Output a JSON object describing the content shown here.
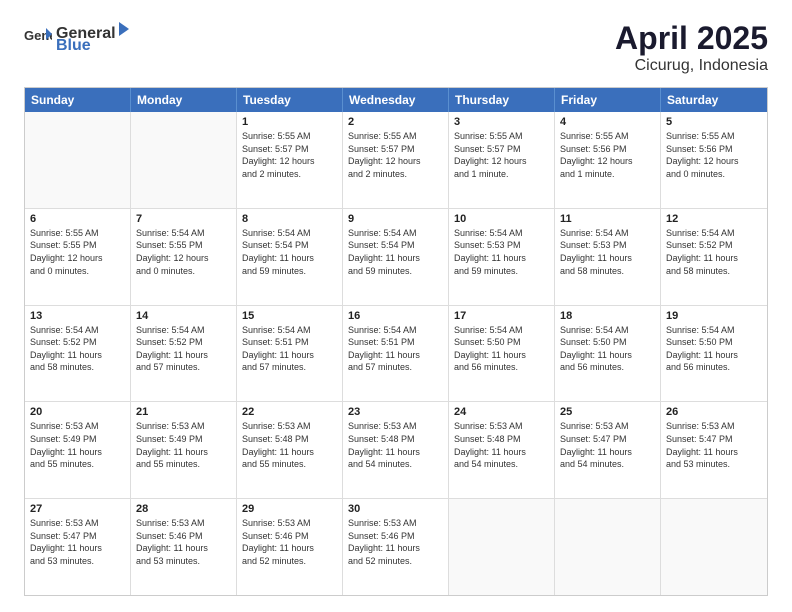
{
  "header": {
    "logo_general": "General",
    "logo_blue": "Blue",
    "title": "April 2025",
    "location": "Cicurug, Indonesia"
  },
  "weekdays": [
    "Sunday",
    "Monday",
    "Tuesday",
    "Wednesday",
    "Thursday",
    "Friday",
    "Saturday"
  ],
  "rows": [
    [
      {
        "day": "",
        "info": ""
      },
      {
        "day": "",
        "info": ""
      },
      {
        "day": "1",
        "info": "Sunrise: 5:55 AM\nSunset: 5:57 PM\nDaylight: 12 hours\nand 2 minutes."
      },
      {
        "day": "2",
        "info": "Sunrise: 5:55 AM\nSunset: 5:57 PM\nDaylight: 12 hours\nand 2 minutes."
      },
      {
        "day": "3",
        "info": "Sunrise: 5:55 AM\nSunset: 5:57 PM\nDaylight: 12 hours\nand 1 minute."
      },
      {
        "day": "4",
        "info": "Sunrise: 5:55 AM\nSunset: 5:56 PM\nDaylight: 12 hours\nand 1 minute."
      },
      {
        "day": "5",
        "info": "Sunrise: 5:55 AM\nSunset: 5:56 PM\nDaylight: 12 hours\nand 0 minutes."
      }
    ],
    [
      {
        "day": "6",
        "info": "Sunrise: 5:55 AM\nSunset: 5:55 PM\nDaylight: 12 hours\nand 0 minutes."
      },
      {
        "day": "7",
        "info": "Sunrise: 5:54 AM\nSunset: 5:55 PM\nDaylight: 12 hours\nand 0 minutes."
      },
      {
        "day": "8",
        "info": "Sunrise: 5:54 AM\nSunset: 5:54 PM\nDaylight: 11 hours\nand 59 minutes."
      },
      {
        "day": "9",
        "info": "Sunrise: 5:54 AM\nSunset: 5:54 PM\nDaylight: 11 hours\nand 59 minutes."
      },
      {
        "day": "10",
        "info": "Sunrise: 5:54 AM\nSunset: 5:53 PM\nDaylight: 11 hours\nand 59 minutes."
      },
      {
        "day": "11",
        "info": "Sunrise: 5:54 AM\nSunset: 5:53 PM\nDaylight: 11 hours\nand 58 minutes."
      },
      {
        "day": "12",
        "info": "Sunrise: 5:54 AM\nSunset: 5:52 PM\nDaylight: 11 hours\nand 58 minutes."
      }
    ],
    [
      {
        "day": "13",
        "info": "Sunrise: 5:54 AM\nSunset: 5:52 PM\nDaylight: 11 hours\nand 58 minutes."
      },
      {
        "day": "14",
        "info": "Sunrise: 5:54 AM\nSunset: 5:52 PM\nDaylight: 11 hours\nand 57 minutes."
      },
      {
        "day": "15",
        "info": "Sunrise: 5:54 AM\nSunset: 5:51 PM\nDaylight: 11 hours\nand 57 minutes."
      },
      {
        "day": "16",
        "info": "Sunrise: 5:54 AM\nSunset: 5:51 PM\nDaylight: 11 hours\nand 57 minutes."
      },
      {
        "day": "17",
        "info": "Sunrise: 5:54 AM\nSunset: 5:50 PM\nDaylight: 11 hours\nand 56 minutes."
      },
      {
        "day": "18",
        "info": "Sunrise: 5:54 AM\nSunset: 5:50 PM\nDaylight: 11 hours\nand 56 minutes."
      },
      {
        "day": "19",
        "info": "Sunrise: 5:54 AM\nSunset: 5:50 PM\nDaylight: 11 hours\nand 56 minutes."
      }
    ],
    [
      {
        "day": "20",
        "info": "Sunrise: 5:53 AM\nSunset: 5:49 PM\nDaylight: 11 hours\nand 55 minutes."
      },
      {
        "day": "21",
        "info": "Sunrise: 5:53 AM\nSunset: 5:49 PM\nDaylight: 11 hours\nand 55 minutes."
      },
      {
        "day": "22",
        "info": "Sunrise: 5:53 AM\nSunset: 5:48 PM\nDaylight: 11 hours\nand 55 minutes."
      },
      {
        "day": "23",
        "info": "Sunrise: 5:53 AM\nSunset: 5:48 PM\nDaylight: 11 hours\nand 54 minutes."
      },
      {
        "day": "24",
        "info": "Sunrise: 5:53 AM\nSunset: 5:48 PM\nDaylight: 11 hours\nand 54 minutes."
      },
      {
        "day": "25",
        "info": "Sunrise: 5:53 AM\nSunset: 5:47 PM\nDaylight: 11 hours\nand 54 minutes."
      },
      {
        "day": "26",
        "info": "Sunrise: 5:53 AM\nSunset: 5:47 PM\nDaylight: 11 hours\nand 53 minutes."
      }
    ],
    [
      {
        "day": "27",
        "info": "Sunrise: 5:53 AM\nSunset: 5:47 PM\nDaylight: 11 hours\nand 53 minutes."
      },
      {
        "day": "28",
        "info": "Sunrise: 5:53 AM\nSunset: 5:46 PM\nDaylight: 11 hours\nand 53 minutes."
      },
      {
        "day": "29",
        "info": "Sunrise: 5:53 AM\nSunset: 5:46 PM\nDaylight: 11 hours\nand 52 minutes."
      },
      {
        "day": "30",
        "info": "Sunrise: 5:53 AM\nSunset: 5:46 PM\nDaylight: 11 hours\nand 52 minutes."
      },
      {
        "day": "",
        "info": ""
      },
      {
        "day": "",
        "info": ""
      },
      {
        "day": "",
        "info": ""
      }
    ]
  ]
}
